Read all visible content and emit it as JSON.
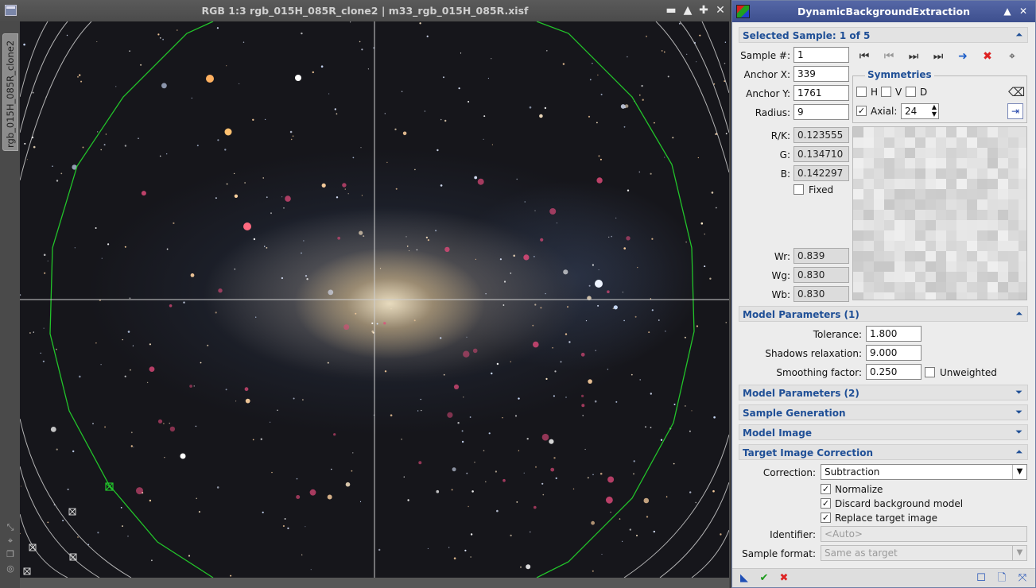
{
  "image_window": {
    "title": "RGB 1:3 rgb_015H_085R_clone2 | m33_rgb_015H_085R.xisf",
    "view_tab": "rgb_015H_085R_clone2",
    "controls": [
      "minimize-icon",
      "shade-icon",
      "maximize-icon",
      "close-icon"
    ],
    "overlay_color": "#22c32a",
    "crosshair_color": "#c8c8c8"
  },
  "process": {
    "title": "DynamicBackgroundExtraction",
    "selected_sample": {
      "header": "Selected Sample: 1 of 5",
      "sample_label": "Sample #:",
      "sample_value": "1",
      "anchor_x_label": "Anchor X:",
      "anchor_x_value": "339",
      "anchor_y_label": "Anchor Y:",
      "anchor_y_value": "1761",
      "radius_label": "Radius:",
      "radius_value": "9",
      "rk_label": "R/K:",
      "rk_value": "0.123555",
      "g_label": "G:",
      "g_value": "0.134710",
      "b_label": "B:",
      "b_value": "0.142297",
      "fixed_label": "Fixed",
      "fixed_checked": false,
      "wr_label": "Wr:",
      "wr_value": "0.839",
      "wg_label": "Wg:",
      "wg_value": "0.830",
      "wb_label": "Wb:",
      "wb_value": "0.830",
      "symmetries": {
        "title": "Symmetries",
        "h_label": "H",
        "v_label": "V",
        "d_label": "D",
        "axial_label": "Axial:",
        "axial_checked": true,
        "axial_value": "24"
      }
    },
    "model_params_1": {
      "header": "Model Parameters (1)",
      "tolerance_label": "Tolerance:",
      "tolerance_value": "1.800",
      "shadows_label": "Shadows relaxation:",
      "shadows_value": "9.000",
      "smoothing_label": "Smoothing factor:",
      "smoothing_value": "0.250",
      "unweighted_label": "Unweighted",
      "unweighted_checked": false
    },
    "collapsed_sections": [
      "Model Parameters (2)",
      "Sample Generation",
      "Model Image"
    ],
    "target_correction": {
      "header": "Target Image Correction",
      "correction_label": "Correction:",
      "correction_value": "Subtraction",
      "normalize_label": "Normalize",
      "discard_label": "Discard background model",
      "replace_label": "Replace target image",
      "identifier_label": "Identifier:",
      "identifier_placeholder": "<Auto>",
      "sample_format_label": "Sample format:",
      "sample_format_value": "Same as target"
    },
    "accent_color": "#1f4f96"
  }
}
